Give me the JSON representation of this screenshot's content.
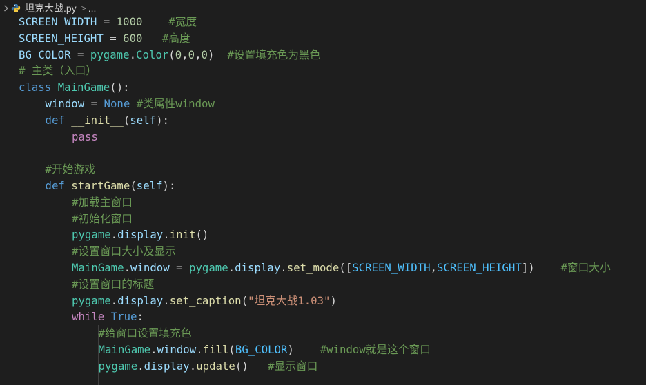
{
  "breadcrumb": {
    "file_name": "坦克大战.py",
    "separator": ">",
    "more": "..."
  },
  "icons": {
    "file_icon": "python-icon",
    "nav_chevron": "chevron-icon"
  },
  "colors": {
    "background": "#1e1e1e",
    "keyword": "#569cd6",
    "control": "#c586c0",
    "class": "#4ec9b0",
    "function": "#dcdcaa",
    "variable": "#9cdcfe",
    "number": "#b5cea8",
    "string": "#ce9178",
    "comment": "#6a9955",
    "constant": "#4fc1ff"
  },
  "code": {
    "lines": [
      {
        "indent": 0,
        "tokens": [
          [
            "var",
            "SCREEN_WIDTH"
          ],
          [
            "op",
            " = "
          ],
          [
            "num",
            "1000"
          ],
          [
            "op",
            "    "
          ],
          [
            "cmt",
            "#宽度"
          ]
        ]
      },
      {
        "indent": 0,
        "tokens": [
          [
            "var",
            "SCREEN_HEIGHT"
          ],
          [
            "op",
            " = "
          ],
          [
            "num",
            "600"
          ],
          [
            "op",
            "   "
          ],
          [
            "cmt",
            "#高度"
          ]
        ]
      },
      {
        "indent": 0,
        "tokens": [
          [
            "var",
            "BG_COLOR"
          ],
          [
            "op",
            " = "
          ],
          [
            "cls",
            "pygame"
          ],
          [
            "op",
            "."
          ],
          [
            "cls",
            "Color"
          ],
          [
            "op",
            "("
          ],
          [
            "num",
            "0"
          ],
          [
            "op",
            ","
          ],
          [
            "num",
            "0"
          ],
          [
            "op",
            ","
          ],
          [
            "num",
            "0"
          ],
          [
            "op",
            ")  "
          ],
          [
            "cmt",
            "#设置填充色为黑色"
          ]
        ]
      },
      {
        "indent": 0,
        "tokens": [
          [
            "cmt",
            "# 主类（入口）"
          ]
        ]
      },
      {
        "indent": 0,
        "tokens": [
          [
            "kw",
            "class"
          ],
          [
            "op",
            " "
          ],
          [
            "cls",
            "MainGame"
          ],
          [
            "op",
            "():"
          ]
        ]
      },
      {
        "indent": 1,
        "tokens": [
          [
            "var",
            "window"
          ],
          [
            "op",
            " = "
          ],
          [
            "kw",
            "None"
          ],
          [
            "op",
            " "
          ],
          [
            "cmt",
            "#类属性window"
          ]
        ]
      },
      {
        "indent": 1,
        "tokens": [
          [
            "kw",
            "def"
          ],
          [
            "op",
            " "
          ],
          [
            "fn",
            "__init__"
          ],
          [
            "op",
            "("
          ],
          [
            "var",
            "self"
          ],
          [
            "op",
            "):"
          ]
        ]
      },
      {
        "indent": 2,
        "tokens": [
          [
            "ctl",
            "pass"
          ]
        ]
      },
      {
        "indent": 1,
        "tokens": []
      },
      {
        "indent": 1,
        "tokens": [
          [
            "cmt",
            "#开始游戏"
          ]
        ]
      },
      {
        "indent": 1,
        "tokens": [
          [
            "kw",
            "def"
          ],
          [
            "op",
            " "
          ],
          [
            "fn",
            "startGame"
          ],
          [
            "op",
            "("
          ],
          [
            "var",
            "self"
          ],
          [
            "op",
            "):"
          ]
        ]
      },
      {
        "indent": 2,
        "tokens": [
          [
            "cmt",
            "#加载主窗口"
          ]
        ]
      },
      {
        "indent": 2,
        "tokens": [
          [
            "cmt",
            "#初始化窗口"
          ]
        ]
      },
      {
        "indent": 2,
        "tokens": [
          [
            "cls",
            "pygame"
          ],
          [
            "op",
            "."
          ],
          [
            "var",
            "display"
          ],
          [
            "op",
            "."
          ],
          [
            "fn",
            "init"
          ],
          [
            "op",
            "()"
          ]
        ]
      },
      {
        "indent": 2,
        "tokens": [
          [
            "cmt",
            "#设置窗口大小及显示"
          ]
        ]
      },
      {
        "indent": 2,
        "tokens": [
          [
            "cls",
            "MainGame"
          ],
          [
            "op",
            "."
          ],
          [
            "var",
            "window"
          ],
          [
            "op",
            " = "
          ],
          [
            "cls",
            "pygame"
          ],
          [
            "op",
            "."
          ],
          [
            "var",
            "display"
          ],
          [
            "op",
            "."
          ],
          [
            "fn",
            "set_mode"
          ],
          [
            "op",
            "(["
          ],
          [
            "cst",
            "SCREEN_WIDTH"
          ],
          [
            "op",
            ","
          ],
          [
            "cst",
            "SCREEN_HEIGHT"
          ],
          [
            "op",
            "])    "
          ],
          [
            "cmt",
            "#窗口大小"
          ]
        ]
      },
      {
        "indent": 2,
        "tokens": [
          [
            "cmt",
            "#设置窗口的标题"
          ]
        ]
      },
      {
        "indent": 2,
        "tokens": [
          [
            "cls",
            "pygame"
          ],
          [
            "op",
            "."
          ],
          [
            "var",
            "display"
          ],
          [
            "op",
            "."
          ],
          [
            "fn",
            "set_caption"
          ],
          [
            "op",
            "("
          ],
          [
            "str",
            "\"坦克大战1.03\""
          ],
          [
            "op",
            ")"
          ]
        ]
      },
      {
        "indent": 2,
        "tokens": [
          [
            "ctl",
            "while"
          ],
          [
            "op",
            " "
          ],
          [
            "kw",
            "True"
          ],
          [
            "op",
            ":"
          ]
        ]
      },
      {
        "indent": 3,
        "tokens": [
          [
            "cmt",
            "#给窗口设置填充色"
          ]
        ]
      },
      {
        "indent": 3,
        "tokens": [
          [
            "cls",
            "MainGame"
          ],
          [
            "op",
            "."
          ],
          [
            "var",
            "window"
          ],
          [
            "op",
            "."
          ],
          [
            "fn",
            "fill"
          ],
          [
            "op",
            "("
          ],
          [
            "cst",
            "BG_COLOR"
          ],
          [
            "op",
            ")    "
          ],
          [
            "cmt",
            "#window就是这个窗口"
          ]
        ]
      },
      {
        "indent": 3,
        "tokens": [
          [
            "cls",
            "pygame"
          ],
          [
            "op",
            "."
          ],
          [
            "var",
            "display"
          ],
          [
            "op",
            "."
          ],
          [
            "fn",
            "update"
          ],
          [
            "op",
            "()   "
          ],
          [
            "cmt",
            "#显示窗口"
          ]
        ]
      },
      {
        "indent": 3,
        "tokens": []
      }
    ]
  }
}
